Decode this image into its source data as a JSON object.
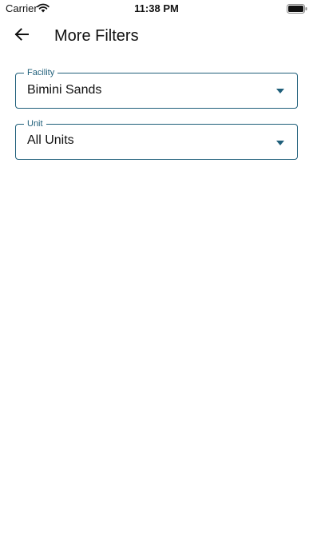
{
  "status_bar": {
    "carrier": "Carrier",
    "time": "11:38 PM",
    "icons": [
      "wifi-icon",
      "battery-icon"
    ]
  },
  "header": {
    "back_icon": "arrow-left-icon",
    "title": "More Filters"
  },
  "filters": {
    "facility": {
      "label": "Facility",
      "value": "Bimini Sands"
    },
    "unit": {
      "label": "Unit",
      "value": "All Units"
    }
  },
  "colors": {
    "accent": "#1f5f7a",
    "text": "#111111",
    "background": "#ffffff"
  }
}
